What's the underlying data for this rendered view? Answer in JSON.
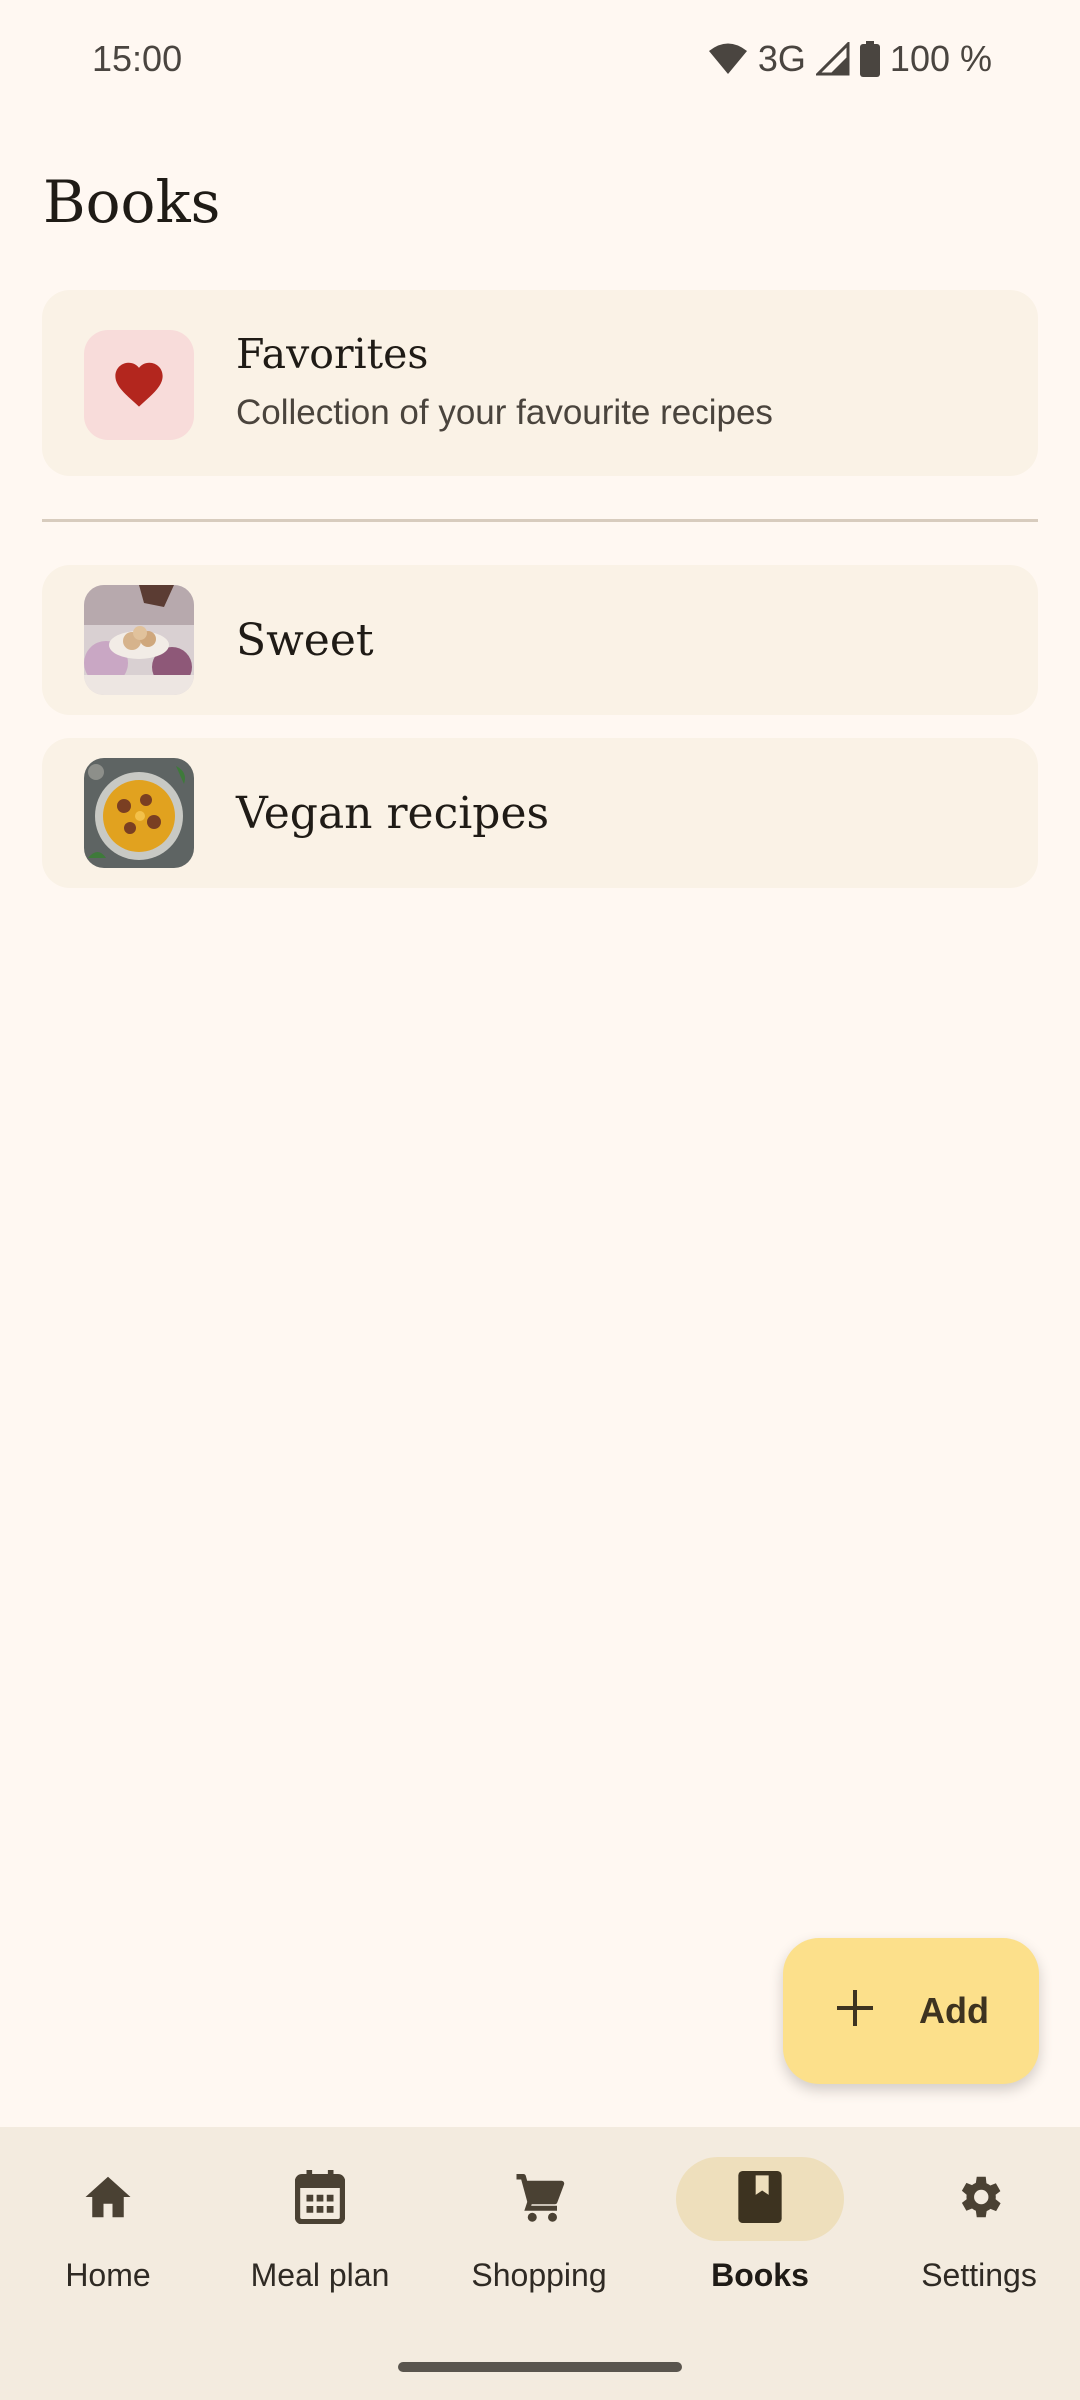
{
  "status_bar": {
    "time": "15:00",
    "network": "3G",
    "battery": "100 %",
    "icons": [
      "wifi-icon",
      "signal-icon",
      "battery-icon"
    ]
  },
  "page": {
    "title": "Books"
  },
  "favorites": {
    "title": "Favorites",
    "subtitle": "Collection of your favourite recipes",
    "icon": "heart-icon",
    "icon_color": "#B3261E"
  },
  "books": [
    {
      "title": "Sweet",
      "thumbnail": "sweet-recipe-thumbnail"
    },
    {
      "title": "Vegan recipes",
      "thumbnail": "vegan-recipe-thumbnail"
    }
  ],
  "fab": {
    "label": "Add",
    "icon": "plus-icon"
  },
  "bottom_nav": {
    "items": [
      {
        "label": "Home",
        "icon": "home-icon",
        "active": false
      },
      {
        "label": "Meal plan",
        "icon": "calendar-icon",
        "active": false
      },
      {
        "label": "Shopping",
        "icon": "cart-icon",
        "active": false
      },
      {
        "label": "Books",
        "icon": "book-icon",
        "active": true
      },
      {
        "label": "Settings",
        "icon": "gear-icon",
        "active": false
      }
    ]
  },
  "colors": {
    "background": "#FFF8F2",
    "card": "#FAF2E6",
    "fab": "#FCE08B",
    "nav_active_pill": "#EEDFBC",
    "nav_background": "#F3EBDF"
  }
}
